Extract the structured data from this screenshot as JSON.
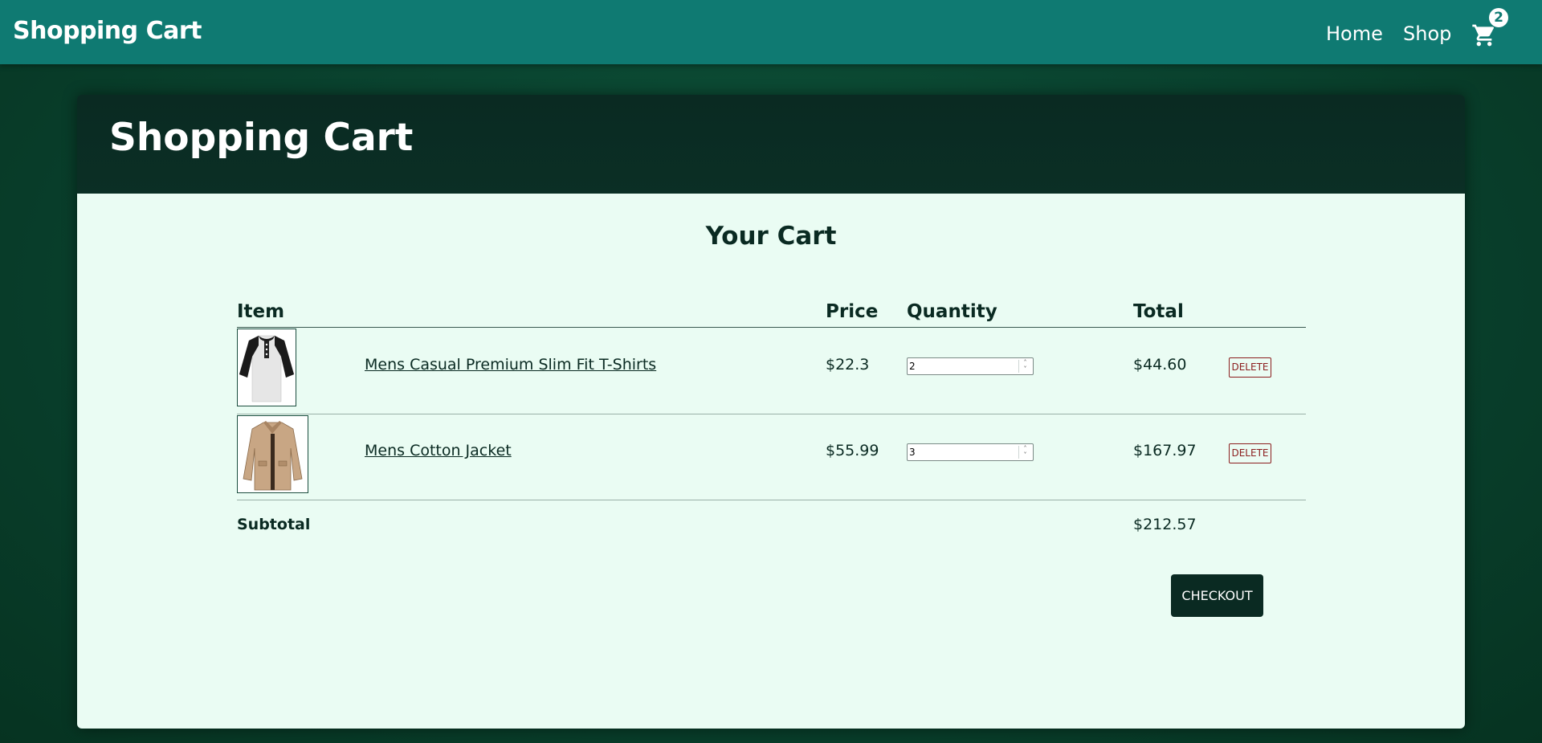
{
  "navbar": {
    "brand": "Shopping Cart",
    "links": [
      "Home",
      "Shop"
    ],
    "cart_count": "2"
  },
  "card": {
    "title": "Shopping Cart",
    "heading": "Your Cart"
  },
  "table": {
    "headers": [
      "Item",
      "Price",
      "Quantity",
      "Total"
    ],
    "rows": [
      {
        "name": "Mens Casual Premium Slim Fit T-Shirts",
        "price": "$22.3",
        "quantity": "2",
        "total": "$44.60",
        "delete_label": "DELETE"
      },
      {
        "name": "Mens Cotton Jacket",
        "price": "$55.99",
        "quantity": "3",
        "total": "$167.97",
        "delete_label": "DELETE"
      }
    ],
    "subtotal_label": "Subtotal",
    "subtotal_value": "$212.57"
  },
  "checkout_label": "CHECKOUT",
  "colors": {
    "navbar": "#0f7a72",
    "page_bg": "#0a4430",
    "card_header": "#0a2a22",
    "card_body": "#eafcf3",
    "delete": "#8b1e1e"
  }
}
